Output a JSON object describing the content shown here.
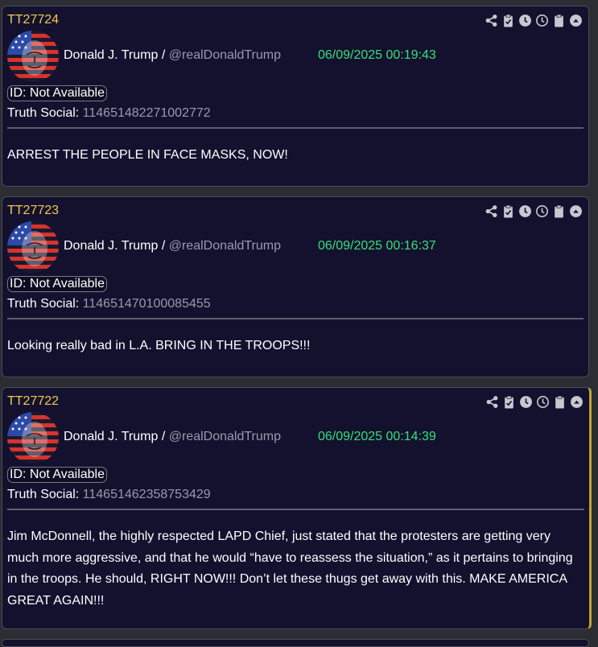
{
  "colors": {
    "background": "#2c2c33",
    "card": "#13112e",
    "post_id": "#f2c94c",
    "timestamp": "#35e07a",
    "handle": "#9a9aaa",
    "selected_accent": "#c4a52b"
  },
  "toolbar_icons": [
    "share-icon",
    "clipboard-check-icon",
    "clock-solid-icon",
    "clock-outline-icon",
    "clipboard-icon",
    "collapse-up-icon"
  ],
  "posts": [
    {
      "id": "TT27724",
      "author": "Donald J. Trump /",
      "handle": "@realDonaldTrump",
      "timestamp": "06/09/2025 00:19:43",
      "id_badge": "ID: Not Available",
      "source_label": "Truth Social:",
      "source_value": "114651482271002772",
      "text": "ARREST THE PEOPLE IN FACE MASKS, NOW!"
    },
    {
      "id": "TT27723",
      "author": "Donald J. Trump /",
      "handle": "@realDonaldTrump",
      "timestamp": "06/09/2025 00:16:37",
      "id_badge": "ID: Not Available",
      "source_label": "Truth Social:",
      "source_value": "114651470100085455",
      "text": "Looking really bad in L.A. BRING IN THE TROOPS!!!"
    },
    {
      "id": "TT27722",
      "author": "Donald J. Trump /",
      "handle": "@realDonaldTrump",
      "timestamp": "06/09/2025 00:14:39",
      "id_badge": "ID: Not Available",
      "source_label": "Truth Social:",
      "source_value": "114651462358753429",
      "text": "Jim McDonnell, the highly respected LAPD Chief, just stated that the protesters are getting very much more aggressive, and that he would “have to reassess the situation,” as it pertains to bringing in the troops. He should, RIGHT NOW!!! Don’t let these thugs get away with this. MAKE AMERICA GREAT AGAIN!!!"
    }
  ]
}
